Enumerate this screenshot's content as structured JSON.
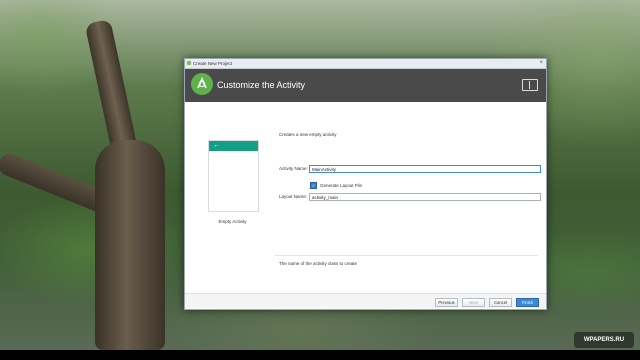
{
  "window": {
    "title": "Create New Project",
    "header_title": "Customize the Activity"
  },
  "preview": {
    "label": "Empty Activity",
    "back_glyph": "←"
  },
  "form": {
    "description": "Creates a new empty activity",
    "activity_name_label": "Activity Name:",
    "activity_name_value": "MainActivity",
    "generate_layout_label": "Generate Layout File",
    "generate_layout_checked": true,
    "layout_name_label": "Layout Name:",
    "layout_name_value": "activity_main"
  },
  "hint": "The name of the activity class to create",
  "buttons": {
    "previous": "Previous",
    "next": "Next",
    "cancel": "Cancel",
    "finish": "Finish"
  },
  "watermark": "WPAPERS.RU",
  "colors": {
    "header_bg": "#4a4a4a",
    "android_green": "#5fb14c",
    "preview_bar": "#15a086",
    "primary_button": "#3b86d6"
  }
}
